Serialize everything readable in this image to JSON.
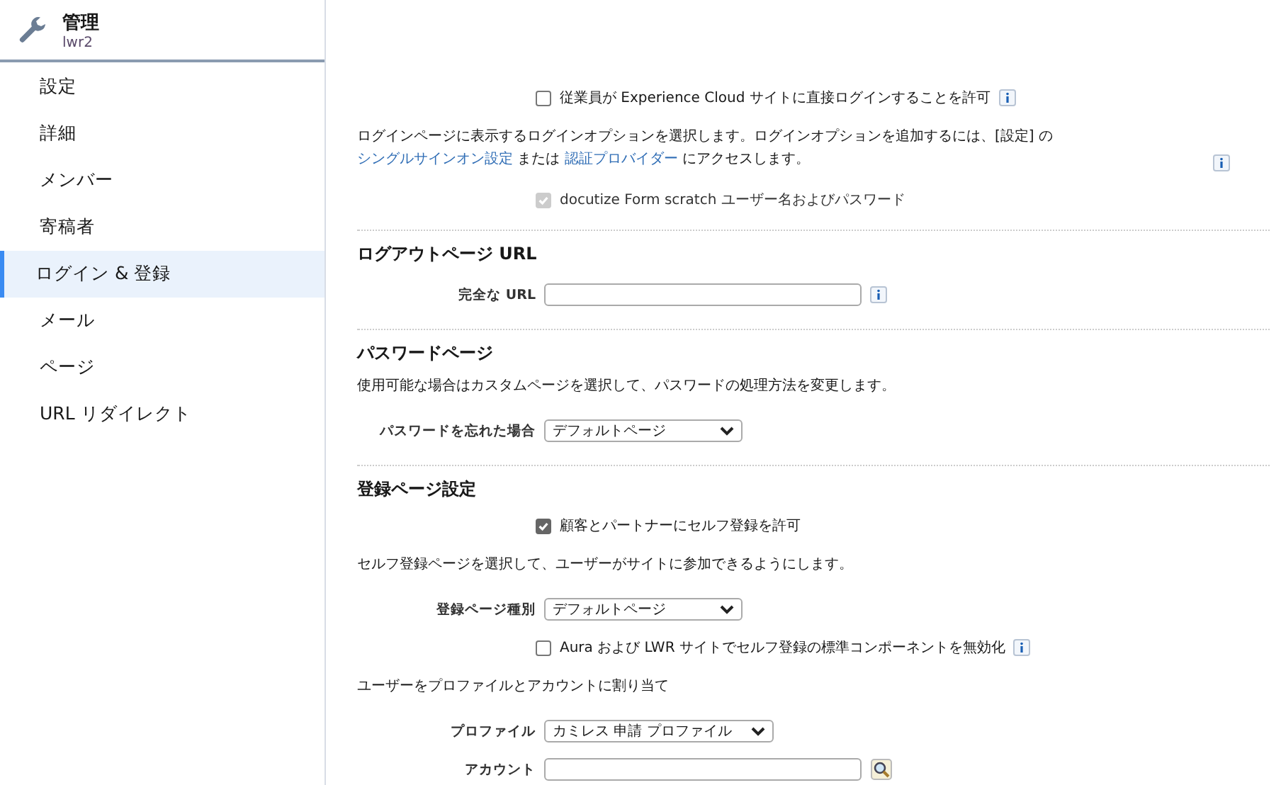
{
  "header": {
    "title": "管理",
    "subtitle": "lwr2"
  },
  "sidebar": {
    "items": [
      {
        "label": "設定",
        "selected": false
      },
      {
        "label": "詳細",
        "selected": false
      },
      {
        "label": "メンバー",
        "selected": false
      },
      {
        "label": "寄稿者",
        "selected": false
      },
      {
        "label": "ログイン & 登録",
        "selected": true
      },
      {
        "label": "メール",
        "selected": false
      },
      {
        "label": "ページ",
        "selected": false
      },
      {
        "label": "URL リダイレクト",
        "selected": false
      }
    ]
  },
  "content": [
    {
      "kind": "checkbox",
      "label": "従業員が Experience Cloud サイトに直接ログインすることを許可",
      "checked": false,
      "disabled": false,
      "info": true
    },
    {
      "kind": "paragraph",
      "segments": [
        {
          "kind": "text",
          "text": "ログインページに表示するログインオプションを選択します。ログインオプションを追加するには、[設定] の "
        },
        {
          "kind": "link",
          "text": "シングルサインオン設定"
        },
        {
          "kind": "text",
          "text": " または "
        },
        {
          "kind": "link",
          "text": "認証プロバイダー"
        },
        {
          "kind": "text",
          "text": " にアクセスします。"
        }
      ],
      "info": true
    },
    {
      "kind": "checkbox",
      "label": "docutize Form scratch ユーザー名およびパスワード",
      "checked": true,
      "disabled": true,
      "info": false
    },
    {
      "kind": "divider"
    },
    {
      "kind": "heading",
      "text": "ログアウトページ URL"
    },
    {
      "kind": "field",
      "label": "完全な URL",
      "info": true
    },
    {
      "kind": "divider"
    },
    {
      "kind": "heading",
      "text": "パスワードページ"
    },
    {
      "kind": "paragraph",
      "segments": [
        {
          "kind": "text",
          "text": "使用可能な場合はカスタムページを選択して、パスワードの処理方法を変更します。"
        }
      ],
      "info": false
    },
    {
      "kind": "select",
      "label": "パスワードを忘れた場合",
      "value": "デフォルトページ"
    },
    {
      "kind": "divider"
    },
    {
      "kind": "heading",
      "text": "登録ページ設定"
    },
    {
      "kind": "checkbox",
      "label": "顧客とパートナーにセルフ登録を許可",
      "checked": true,
      "disabled": false,
      "info": false
    },
    {
      "kind": "paragraph",
      "segments": [
        {
          "kind": "text",
          "text": "セルフ登録ページを選択して、ユーザーがサイトに参加できるようにします。"
        }
      ],
      "info": false
    },
    {
      "kind": "select",
      "label": "登録ページ種別",
      "value": "デフォルトページ"
    },
    {
      "kind": "checkbox",
      "label": "Aura および LWR サイトでセルフ登録の標準コンポーネントを無効化",
      "checked": false,
      "disabled": false,
      "info": true
    },
    {
      "kind": "paragraph",
      "segments": [
        {
          "kind": "text",
          "text": "ユーザーをプロファイルとアカウントに割り当て"
        }
      ],
      "info": false
    },
    {
      "kind": "select",
      "label": "プロファイル",
      "value": "カミレス 申請 プロファイル"
    },
    {
      "kind": "lookup",
      "label": "アカウント"
    }
  ]
}
